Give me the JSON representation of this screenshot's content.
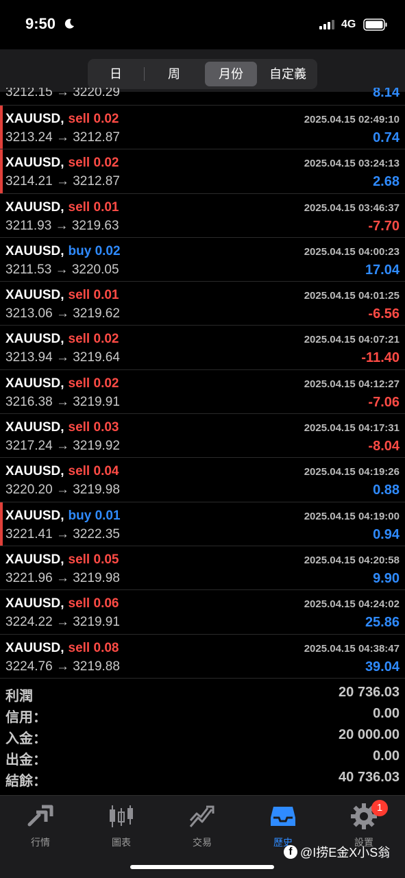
{
  "status": {
    "time": "9:50",
    "network": "4G"
  },
  "segments": [
    {
      "label": "日",
      "active": false
    },
    {
      "label": "周",
      "active": false
    },
    {
      "label": "月份",
      "active": true
    },
    {
      "label": "自定義",
      "active": false
    }
  ],
  "partial_row": {
    "price": "3212.15 → 3220.29",
    "profit": "8.14"
  },
  "trades": [
    {
      "symbol": "XAUUSD,",
      "dir": "sell",
      "lot": "0.02",
      "time": "2025.04.15 02:49:10",
      "price": "3213.24 → 3212.87",
      "profit": "0.74",
      "accent": true
    },
    {
      "symbol": "XAUUSD,",
      "dir": "sell",
      "lot": "0.02",
      "time": "2025.04.15 03:24:13",
      "price": "3214.21 → 3212.87",
      "profit": "2.68",
      "accent": true
    },
    {
      "symbol": "XAUUSD,",
      "dir": "sell",
      "lot": "0.01",
      "time": "2025.04.15 03:46:37",
      "price": "3211.93 → 3219.63",
      "profit": "-7.70",
      "accent": false
    },
    {
      "symbol": "XAUUSD,",
      "dir": "buy",
      "lot": "0.02",
      "time": "2025.04.15 04:00:23",
      "price": "3211.53 → 3220.05",
      "profit": "17.04",
      "accent": false
    },
    {
      "symbol": "XAUUSD,",
      "dir": "sell",
      "lot": "0.01",
      "time": "2025.04.15 04:01:25",
      "price": "3213.06 → 3219.62",
      "profit": "-6.56",
      "accent": false
    },
    {
      "symbol": "XAUUSD,",
      "dir": "sell",
      "lot": "0.02",
      "time": "2025.04.15 04:07:21",
      "price": "3213.94 → 3219.64",
      "profit": "-11.40",
      "accent": false
    },
    {
      "symbol": "XAUUSD,",
      "dir": "sell",
      "lot": "0.02",
      "time": "2025.04.15 04:12:27",
      "price": "3216.38 → 3219.91",
      "profit": "-7.06",
      "accent": false
    },
    {
      "symbol": "XAUUSD,",
      "dir": "sell",
      "lot": "0.03",
      "time": "2025.04.15 04:17:31",
      "price": "3217.24 → 3219.92",
      "profit": "-8.04",
      "accent": false
    },
    {
      "symbol": "XAUUSD,",
      "dir": "sell",
      "lot": "0.04",
      "time": "2025.04.15 04:19:26",
      "price": "3220.20 → 3219.98",
      "profit": "0.88",
      "accent": false
    },
    {
      "symbol": "XAUUSD,",
      "dir": "buy",
      "lot": "0.01",
      "time": "2025.04.15 04:19:00",
      "price": "3221.41 → 3222.35",
      "profit": "0.94",
      "accent": true
    },
    {
      "symbol": "XAUUSD,",
      "dir": "sell",
      "lot": "0.05",
      "time": "2025.04.15 04:20:58",
      "price": "3221.96 → 3219.98",
      "profit": "9.90",
      "accent": false
    },
    {
      "symbol": "XAUUSD,",
      "dir": "sell",
      "lot": "0.06",
      "time": "2025.04.15 04:24:02",
      "price": "3224.22 → 3219.91",
      "profit": "25.86",
      "accent": false
    },
    {
      "symbol": "XAUUSD,",
      "dir": "sell",
      "lot": "0.08",
      "time": "2025.04.15 04:38:47",
      "price": "3224.76 → 3219.88",
      "profit": "39.04",
      "accent": false
    }
  ],
  "summary": [
    {
      "label": "利潤",
      "value": "20 736.03"
    },
    {
      "label": "信用：",
      "value": "0.00"
    },
    {
      "label": "入金：",
      "value": "20 000.00"
    },
    {
      "label": "出金：",
      "value": "0.00"
    },
    {
      "label": "結餘：",
      "value": "40 736.03"
    }
  ],
  "tabs": [
    {
      "label": "行情",
      "icon": "quotes-icon",
      "active": false
    },
    {
      "label": "圖表",
      "icon": "candlestick-icon",
      "active": false
    },
    {
      "label": "交易",
      "icon": "trade-icon",
      "active": false
    },
    {
      "label": "歷史",
      "icon": "history-inbox-icon",
      "active": true
    },
    {
      "label": "設置",
      "icon": "gear-icon",
      "active": false
    }
  ],
  "settings_badge": "1",
  "watermark": "@I捞E金X小S翁",
  "colors": {
    "sell": "#ff4b45",
    "buy": "#2f8bff",
    "accent_bar": "#e0403a",
    "active_tab": "#2f8bff"
  }
}
